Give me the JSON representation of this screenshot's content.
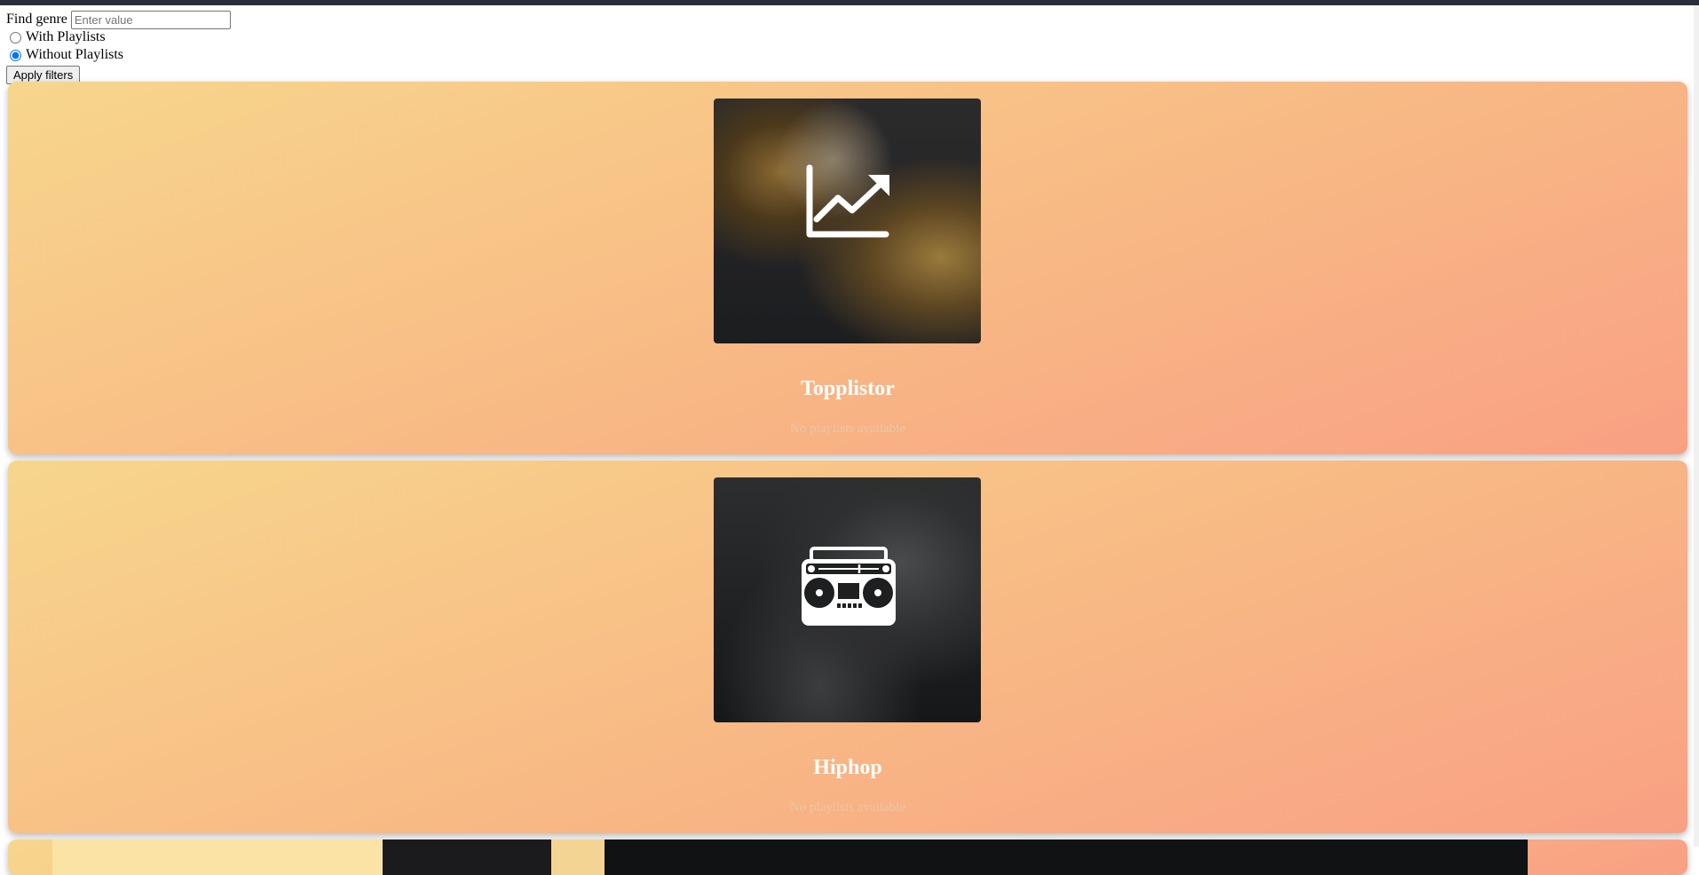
{
  "filters": {
    "find_label": "Find genre",
    "search_placeholder": "Enter value",
    "search_value": "",
    "radio_with": "With Playlists",
    "radio_without": "Without Playlists",
    "selected_option": "Without Playlists",
    "apply_label": "Apply filters"
  },
  "genres": [
    {
      "name": "Topplistor",
      "note": "No playlists available",
      "icon": "trending-up-icon"
    },
    {
      "name": "Hiphop",
      "note": "No playlists available",
      "icon": "boombox-icon"
    }
  ],
  "colors": {
    "card_gradient_start": "#f7d68c",
    "card_gradient_end": "#f9a083",
    "title": "#ffffff",
    "topbar": "#2b2d3a"
  }
}
